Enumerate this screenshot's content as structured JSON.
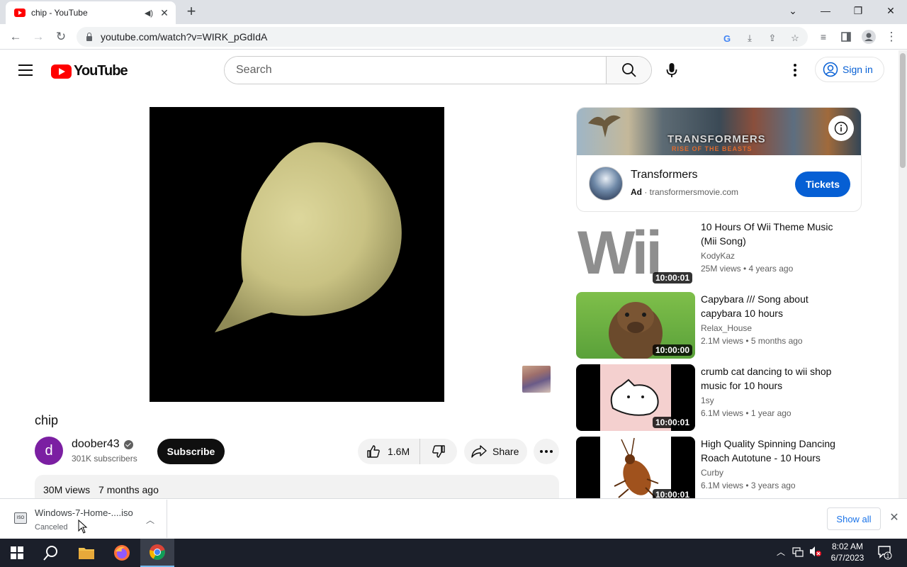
{
  "browser": {
    "tab_title": "chip - YouTube",
    "url": "youtube.com/watch?v=WIRK_pGdIdA"
  },
  "header": {
    "logo_text": "YouTube",
    "search_placeholder": "Search",
    "sign_in_label": "Sign in"
  },
  "video": {
    "title": "chip",
    "channel_name": "doober43",
    "channel_initial": "d",
    "subscribers": "301K subscribers",
    "subscribe_label": "Subscribe",
    "likes": "1.6M",
    "share_label": "Share",
    "views": "30M views",
    "age": "7 months ago"
  },
  "ad": {
    "banner_title": "TRANSFORMERS",
    "banner_subtitle": "RISE OF THE BEASTS",
    "title": "Transformers",
    "ad_label": "Ad",
    "domain": "· transformersmovie.com",
    "cta_label": "Tickets"
  },
  "recommendations": [
    {
      "title": "10 Hours Of Wii Theme Music (Mii Song)",
      "channel": "KodyKaz",
      "meta": "25M views  • 4 years ago",
      "duration": "10:00:01",
      "thumb_text": "Wii"
    },
    {
      "title": "Capybara /// Song about capybara 10 hours",
      "channel": "Relax_House",
      "meta": "2.1M views  • 5 months ago",
      "duration": "10:00:00"
    },
    {
      "title": "crumb cat dancing to wii shop music for 10 hours",
      "channel": "1sy",
      "meta": "6.1M views  • 1 year ago",
      "duration": "10:00:01"
    },
    {
      "title": "High Quality Spinning Dancing Roach Autotune - 10 Hours",
      "channel": "Curby",
      "meta": "6.1M views  • 3 years ago",
      "duration": "10:00:01"
    }
  ],
  "download": {
    "icon_label": "ISO",
    "filename": "Windows-7-Home-....iso",
    "status": "Canceled",
    "show_all_label": "Show all"
  },
  "taskbar": {
    "time": "8:02 AM",
    "date": "6/7/2023",
    "notification_count": "1"
  },
  "colors": {
    "youtube_red": "#ff0000",
    "link_blue": "#065fd4",
    "avatar_purple": "#7b1fa2"
  }
}
